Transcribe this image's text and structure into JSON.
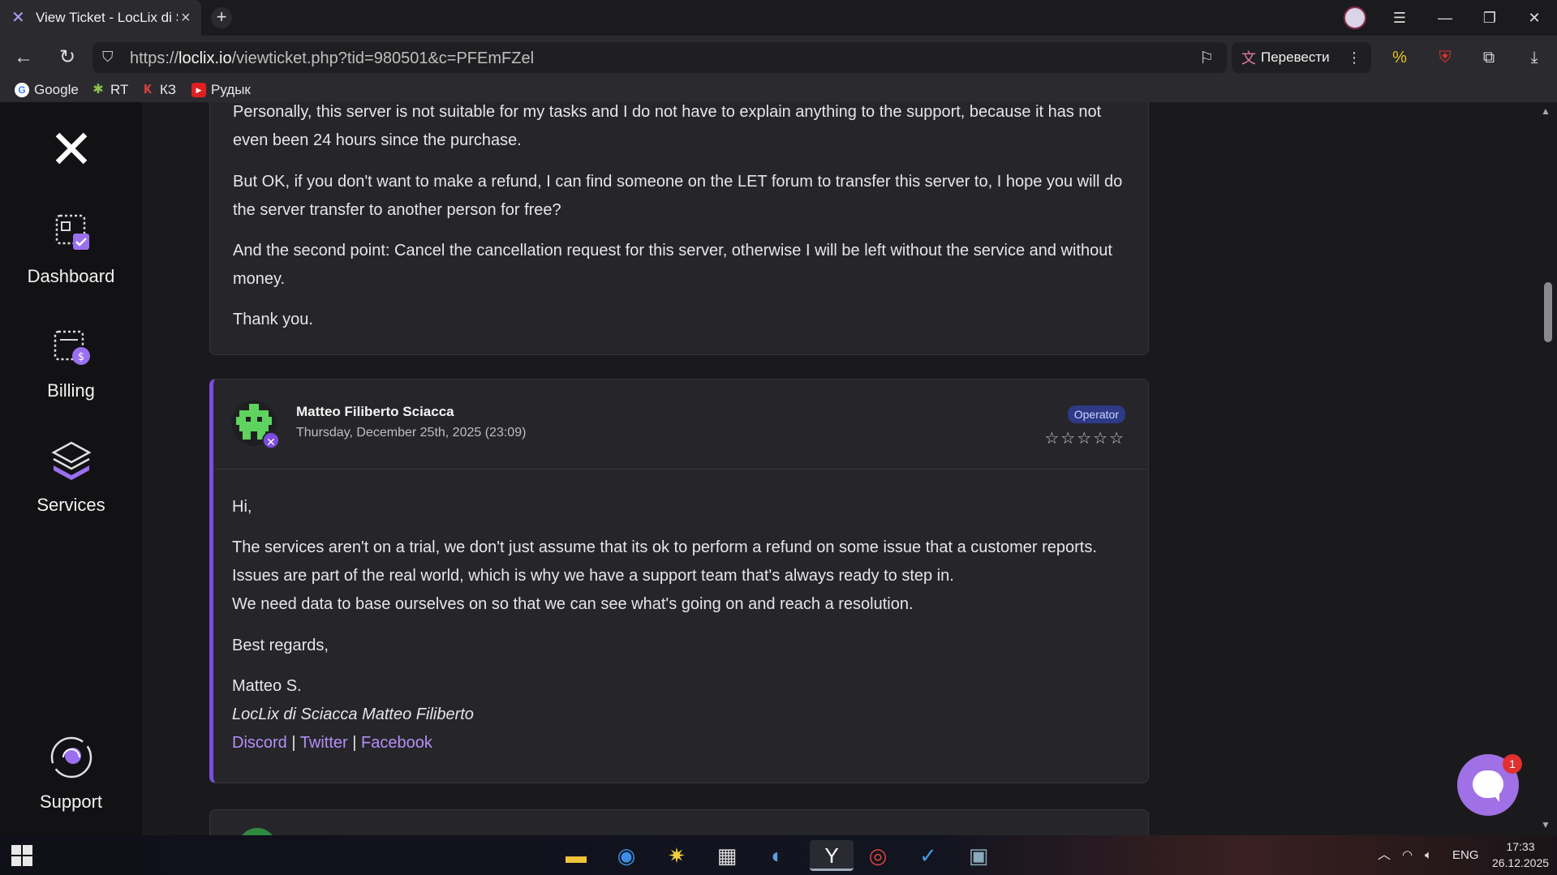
{
  "browser": {
    "tab_title": "View Ticket - LocLix di S",
    "url_prefix": "https://",
    "url_host": "loclix.io",
    "url_path": "/viewticket.php?tid=980501&c=PFEmFZel",
    "translate_label": "Перевести",
    "bookmarks": [
      {
        "label": "Google",
        "color": "#4285f4",
        "glyph": "G"
      },
      {
        "label": "RT",
        "color": "#6ab04c",
        "glyph": "✱"
      },
      {
        "label": "КЗ",
        "color": "#c0392b",
        "glyph": "К"
      },
      {
        "label": "Рудык",
        "color": "#e02020",
        "glyph": "▶"
      }
    ]
  },
  "sidebar": {
    "items": [
      {
        "label": "Dashboard",
        "icon": "dashboard-icon"
      },
      {
        "label": "Billing",
        "icon": "billing-icon"
      },
      {
        "label": "Services",
        "icon": "services-icon"
      },
      {
        "label": "Support",
        "icon": "support-icon"
      }
    ]
  },
  "messages": [
    {
      "paragraphs": [
        "Personally, this server is not suitable for my tasks and I do not have to explain anything to the support, because it has not even been 24 hours since the purchase.",
        "But OK, if you don't want to make a refund, I can find someone on the LET forum to transfer this server to, I hope you will do the server transfer to another person for free?",
        "And the second point: Cancel the cancellation request for this server, otherwise I will be left without the service and without money.",
        "Thank you."
      ]
    },
    {
      "author": "Matteo Filiberto Sciacca",
      "date": "Thursday, December 25th, 2025 (23:09)",
      "role": "Operator",
      "rating_stars": "☆☆☆☆☆",
      "greeting": "Hi,",
      "body_line1": "The services aren't on a trial, we don't just assume that its ok to perform a refund on some issue that a customer reports. Issues are part of the real world, which is why we have a support team that's always ready to step in.",
      "body_line2": "We need data to base ourselves on so that we can see what's going on and reach a resolution.",
      "closing": "Best regards,",
      "signature_name": "Matteo S.",
      "signature_company": "LocLix di Sciacca Matteo Filiberto",
      "links": [
        "Discord",
        "Twitter",
        "Facebook"
      ]
    }
  ],
  "chat": {
    "notification_count": "1"
  },
  "taskbar": {
    "language": "ENG",
    "time": "17:33",
    "date": "26.12.2025"
  },
  "colors": {
    "accent": "#7c4dde",
    "link": "#b48ff5",
    "operator_badge": "#2e3a87"
  }
}
